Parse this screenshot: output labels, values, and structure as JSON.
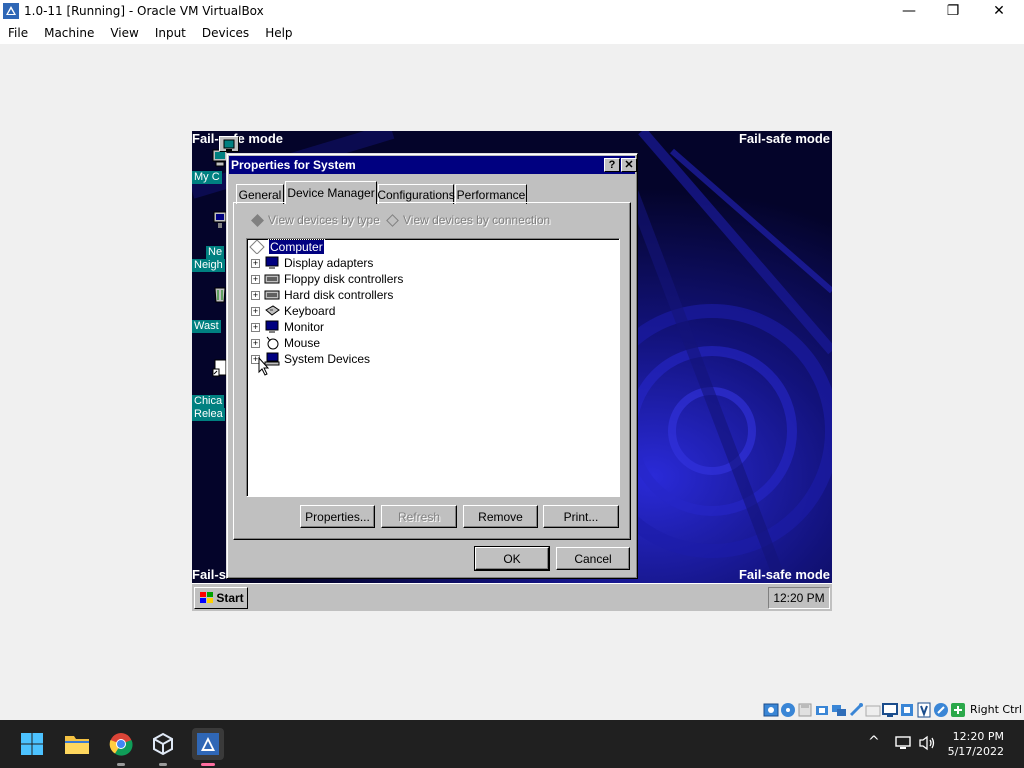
{
  "host_window": {
    "title": "1.0-11 [Running] - Oracle VM VirtualBox",
    "controls": {
      "minimize": "—",
      "restore": "❐",
      "close": "✕"
    },
    "menu": [
      "File",
      "Machine",
      "View",
      "Input",
      "Devices",
      "Help"
    ]
  },
  "guest": {
    "failsafe_text": "Fail-safe mode",
    "failsafe_partial_left": "Fail-s",
    "desktop_icons": [
      {
        "label_lines": [
          "My C"
        ]
      },
      {
        "label_lines": [
          "Ne",
          "Neigh"
        ]
      },
      {
        "label_lines": [
          "Wast"
        ]
      },
      {
        "label_lines": [
          "Chica",
          "Relea"
        ]
      }
    ],
    "dialog": {
      "title": "Properties for System",
      "help_btn": "?",
      "close_btn": "✕",
      "tabs": [
        "General",
        "Device Manager",
        "Configurations",
        "Performance"
      ],
      "active_tab": "Device Manager",
      "radio_by_type": "View devices by type",
      "radio_by_connection": "View devices by connection",
      "tree": {
        "root": "Computer",
        "children": [
          {
            "label": "Display adapters",
            "icon": "display-adapter-icon"
          },
          {
            "label": "Floppy disk controllers",
            "icon": "floppy-controller-icon"
          },
          {
            "label": "Hard disk controllers",
            "icon": "harddisk-controller-icon"
          },
          {
            "label": "Keyboard",
            "icon": "keyboard-icon"
          },
          {
            "label": "Monitor",
            "icon": "monitor-icon"
          },
          {
            "label": "Mouse",
            "icon": "mouse-icon"
          },
          {
            "label": "System Devices",
            "icon": "system-devices-icon"
          }
        ]
      },
      "buttons": {
        "properties": "Properties...",
        "refresh": "Refresh",
        "remove": "Remove",
        "print": "Print..."
      },
      "ok": "OK",
      "cancel": "Cancel"
    },
    "taskbar": {
      "start": "Start",
      "clock": "12:20 PM"
    }
  },
  "host_statusbar": {
    "host_key": "Right Ctrl"
  },
  "win_taskbar": {
    "time": "12:20 PM",
    "date": "5/17/2022",
    "tray_chevron": "^"
  },
  "colors": {
    "guest_titlebar": "#000080",
    "guest_face": "#c0c0c0",
    "guest_desktop": "#050530",
    "desktop_label_bg": "#008080",
    "host_taskbar": "#202020"
  }
}
